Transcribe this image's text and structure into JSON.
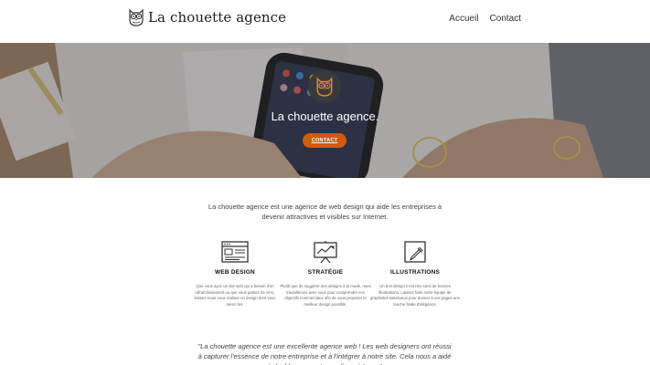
{
  "header": {
    "logo_text": "La chouette agence",
    "logo_icon": "owl-icon",
    "nav": [
      {
        "label": "Accueil"
      },
      {
        "label": "Contact"
      }
    ]
  },
  "hero": {
    "title": "La chouette agence.",
    "button_label": "CONTACT",
    "accent_color": "#d4590f"
  },
  "intro": {
    "text": "La chouette agence est une agence de web design qui aide les entreprises à devenir attractives et visibles sur Internet."
  },
  "features": [
    {
      "icon": "browser-window-icon",
      "title": "WEB DESIGN",
      "text": "Que vous ayez un site web qui a besoin d'un rafraîchissement ou que vous partiez de zéro, laissez-nous vous réaliser un design dont vous serez fier."
    },
    {
      "icon": "presentation-chart-icon",
      "title": "STRATÉGIE",
      "text": "Plutôt que de suggérer des designs à la mode, nous travaillerons avec vous pour comprendre vos objectifs commerciaux afin de vous proposer le meilleur design possible."
    },
    {
      "icon": "pencil-icon",
      "title": "ILLUSTRATIONS",
      "text": "Un bon design n'est rien sans de bonnes illustrations. Laissez faire notre équipe de graphistes talentueux pour donner à vos pages une touche finale d'élégance."
    }
  ],
  "testimonial": {
    "text": "\"La chouette agence est une excellente agence web ! Les web designers ont réussi à capturer l'essence de notre entreprise et à l'intégrer à notre site. Cela nous a aidé à doublernos ventes en ligne à Lyon.\""
  }
}
